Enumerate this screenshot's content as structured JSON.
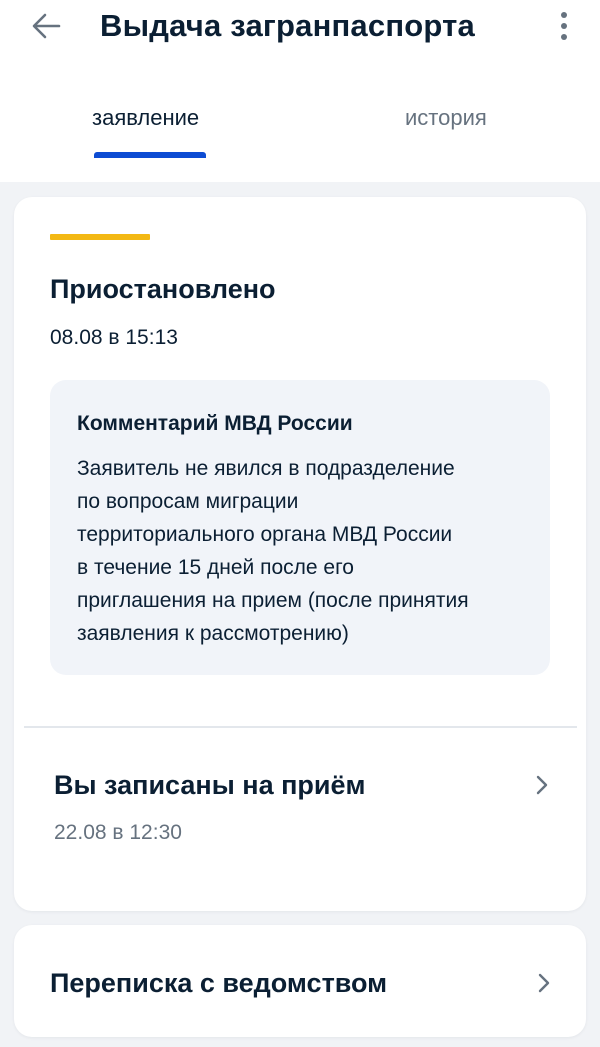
{
  "header": {
    "title": "Выдача загранпаспорта"
  },
  "tabs": [
    {
      "label": "заявление",
      "active": true
    },
    {
      "label": "история",
      "active": false
    }
  ],
  "status": {
    "title": "Приостановлено",
    "date": "08.08 в 15:13",
    "accent_color": "#f3b814"
  },
  "comment": {
    "title": "Комментарий МВД России",
    "text": "Заявитель не явился в подразделение\nпо вопросам миграции\nтерриториального органа МВД России\nв течение 15 дней после его\nприглашения на прием (после принятия\nзаявления к рассмотрению)"
  },
  "appointment": {
    "title": "Вы записаны на приём",
    "date": "22.08 в 12:30"
  },
  "correspondence": {
    "title": "Переписка с ведомством"
  },
  "icons": {
    "back": "arrow-left-icon",
    "menu": "more-vertical-icon",
    "chevron": "chevron-right-icon"
  },
  "colors": {
    "primary": "#0d4cd3",
    "text": "#0b1f33",
    "muted": "#66727f",
    "background": "#f1f3f6"
  }
}
